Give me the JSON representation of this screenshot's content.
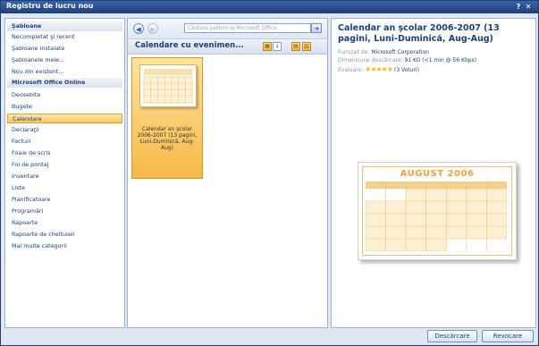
{
  "window": {
    "title": "Registru de lucru nou",
    "help_glyph": "?",
    "close_glyph": "✕"
  },
  "sidebar": {
    "items": [
      {
        "label": "Şabloane",
        "kind": "header"
      },
      {
        "label": "Necompletat şi recent",
        "kind": "item"
      },
      {
        "label": "Şabloane instalate",
        "kind": "item"
      },
      {
        "label": "Şabloanele mele...",
        "kind": "item"
      },
      {
        "label": "Nou din existent...",
        "kind": "item"
      },
      {
        "label": "Microsoft Office Online",
        "kind": "header"
      },
      {
        "label": "Deosebite",
        "kind": "item"
      },
      {
        "label": "Bugete",
        "kind": "item"
      },
      {
        "label": "Calendare",
        "kind": "selected"
      },
      {
        "label": "Declaraţii",
        "kind": "item"
      },
      {
        "label": "Facturi",
        "kind": "item"
      },
      {
        "label": "Foaie de scris",
        "kind": "item"
      },
      {
        "label": "Foi de pontaj",
        "kind": "item"
      },
      {
        "label": "Inventare",
        "kind": "item"
      },
      {
        "label": "Liste",
        "kind": "item"
      },
      {
        "label": "Planificatoare",
        "kind": "item"
      },
      {
        "label": "Programări",
        "kind": "item"
      },
      {
        "label": "Rapoarte",
        "kind": "item"
      },
      {
        "label": "Rapoarte de cheltuieli",
        "kind": "item"
      },
      {
        "label": "Mai multe categorii",
        "kind": "item"
      }
    ]
  },
  "middle": {
    "search_placeholder": "Căutare şabloni la Microsoft Office",
    "back_glyph": "◀",
    "forward_glyph": "▶",
    "go_glyph": "➜",
    "category_title": "Calendare cu evenimen...",
    "template": {
      "caption": "Calendar an şcolar 2006-2007 (13 pagini, Luni-Duminică, Aug-Aug)"
    }
  },
  "details": {
    "title": "Calendar an şcolar 2006-2007 (13 pagini, Luni-Duminică, Aug-Aug)",
    "provider_label": "Furnizat de:",
    "provider_value": "Microsoft Corporation",
    "size_label": "Dimensiune descărcare:",
    "size_value": "91 KO (<1 min @ 56 Kbps)",
    "rating_label": "Evaluare:",
    "rating_stars": "★★★★★",
    "rating_votes": "(3 Voturi)",
    "preview_month": "AUGUST 2006"
  },
  "buttons": {
    "download": "Descărcare",
    "cancel": "Revocare"
  },
  "colors": {
    "accent": "#1b3f7e",
    "selection": "#f8c560",
    "calendar": "#f0a23c"
  }
}
